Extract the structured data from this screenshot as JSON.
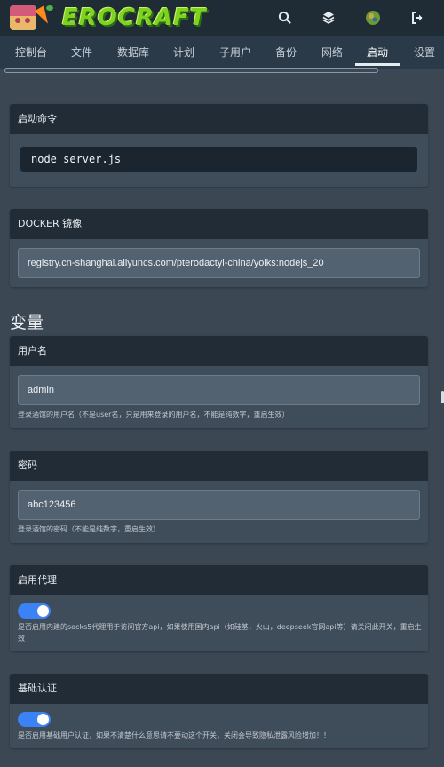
{
  "app": {
    "logo_text": "EROCRAFT"
  },
  "topbar": {
    "icons": [
      "search-icon",
      "layers-icon",
      "avatar",
      "logout-icon"
    ]
  },
  "tabs": [
    {
      "label": "控制台"
    },
    {
      "label": "文件"
    },
    {
      "label": "数据库"
    },
    {
      "label": "计划"
    },
    {
      "label": "子用户"
    },
    {
      "label": "备份"
    },
    {
      "label": "网络"
    },
    {
      "label": "启动",
      "active": true
    },
    {
      "label": "设置"
    }
  ],
  "startup": {
    "header": "启动命令",
    "command": "node server.js"
  },
  "docker": {
    "header": "DOCKER 镜像",
    "image": "registry.cn-shanghai.aliyuncs.com/pterodactyl-china/yolks:nodejs_20"
  },
  "variables": {
    "title": "变量",
    "username": {
      "label": "用户名",
      "value": "admin",
      "help": "登录酒馆的用户名（不是user名，只是用来登录的用户名，不能是纯数字，重启生效）"
    },
    "password": {
      "label": "密码",
      "value": "abc123456",
      "help": "登录酒馆的密码（不能是纯数字，重启生效）"
    },
    "proxy": {
      "label": "启用代理",
      "enabled": true,
      "help": "是否启用内建的socks5代理用于访问官方api，如果使用国内api（如硅基，火山，deepseek官网api等）请关闭此开关，重启生效"
    },
    "basic_auth": {
      "label": "基础认证",
      "enabled": true,
      "help": "是否启用基础用户认证，如果不清楚什么意思请不要动这个开关，关闭会导致隐私泄露风险增加！！"
    }
  },
  "colors": {
    "background": "#3b4753",
    "topbar": "#1f2b35",
    "card_header": "#222c36",
    "toggle_on": "#3b82f6",
    "logo": "#7ed321"
  }
}
